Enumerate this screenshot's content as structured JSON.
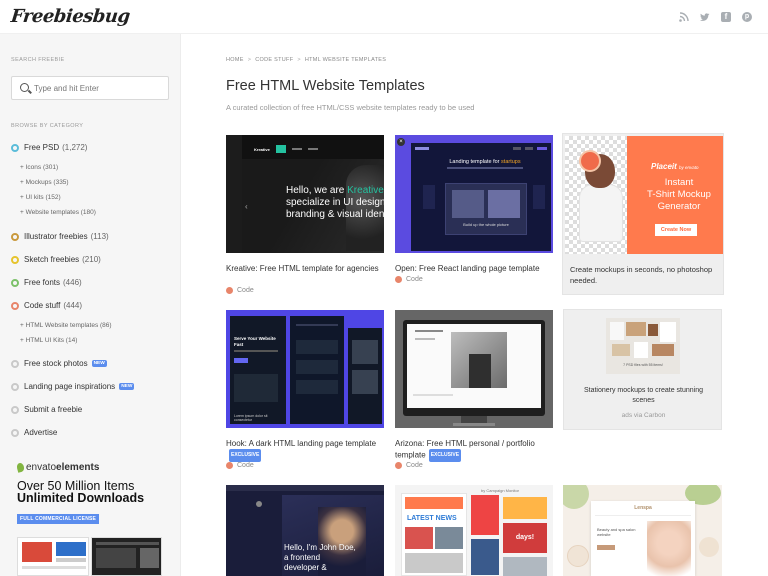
{
  "header": {
    "logo": "Freebiesbug",
    "social": [
      "rss-icon",
      "twitter-icon",
      "facebook-icon",
      "pinterest-icon"
    ]
  },
  "sidebar": {
    "search_heading": "SEARCH FREEBIE",
    "search_placeholder": "Type and hit Enter",
    "browse_heading": "BROWSE BY CATEGORY",
    "categories": [
      {
        "label": "Free PSD",
        "count": "(1,272)",
        "color": "#5bbcd9"
      },
      {
        "label": "Illustrator freebies",
        "count": "(113)",
        "color": "#c9993d"
      },
      {
        "label": "Sketch freebies",
        "count": "(210)",
        "color": "#e6c42d"
      },
      {
        "label": "Free fonts",
        "count": "(446)",
        "color": "#7cc16a"
      },
      {
        "label": "Code stuff",
        "count": "(444)",
        "color": "#e8856a"
      }
    ],
    "psd_subs": [
      "+ Icons (301)",
      "+ Mockups (335)",
      "+ UI kits (152)",
      "+ Website templates (180)"
    ],
    "code_subs": [
      "+ HTML Website templates (86)",
      "+ HTML UI Kits (14)"
    ],
    "links": [
      {
        "label": "Free stock photos",
        "badge": "NEW"
      },
      {
        "label": "Landing page inspirations",
        "badge": "NEW"
      },
      {
        "label": "Submit a freebie",
        "badge": ""
      },
      {
        "label": "Advertise",
        "badge": ""
      }
    ],
    "ad": {
      "brand_a": "envato",
      "brand_b": "elements",
      "line1": "Over 50 Million Items",
      "line2": "Unlimited Downloads",
      "license": "FULL COMMERCIAL LICENSE"
    }
  },
  "main": {
    "breadcrumb": [
      "HOME",
      "CODE STUFF",
      "HTML WEBSITE TEMPLATES"
    ],
    "title": "Free HTML Website Templates",
    "subtitle": "A curated collection of free HTML/CSS website templates ready to be used",
    "cards": [
      {
        "title": "Kreative: Free HTML template for agencies",
        "tag": "Code",
        "exclusive": ""
      },
      {
        "title": "Open: Free React landing page template",
        "tag": "Code",
        "exclusive": ""
      },
      {
        "title": "Hook: A dark HTML landing page template",
        "tag": "Code",
        "exclusive": "EXCLUSIVE"
      },
      {
        "title": "Arizona: Free HTML personal / portfolio template",
        "tag": "Code",
        "exclusive": "EXCLUSIVE"
      }
    ],
    "thumbs": {
      "kreative": {
        "line1": "Hello, we are ",
        "highlight": "Kreative.",
        "line2": "specialize in UI design",
        "line3": "branding & visual identity",
        "nav": "Kreative"
      },
      "open": {
        "headline": "Landing template for ",
        "highlight": "startups",
        "sub": "Build up the whole picture"
      },
      "hook": {
        "headline": "Serve Your Website Fast",
        "caption": "Lorem ipsum dolor sit consectetur"
      },
      "johndoe": {
        "line1": "Hello, I'm John Doe,",
        "line2": "a frontend",
        "line3": "developer &"
      },
      "news": {
        "brand": "by Campaign Monitor",
        "headline": "LATEST NEWS",
        "badge": "days!"
      },
      "lenspa": {
        "brand": "Lenspa",
        "text": "Beauty and spa salon website"
      }
    },
    "ads": {
      "placeit": {
        "brand": "Placeit",
        "by": "by envato",
        "l1": "Instant",
        "l2": "T-Shirt Mockup",
        "l3": "Generator",
        "cta": "Create Now",
        "caption": "Create mockups in seconds, no photoshop needed."
      },
      "carbon": {
        "inner": "7 PSD files with 55 items!",
        "caption": "Stationery mockups to create stunning scenes",
        "via": "ads via Carbon"
      }
    }
  }
}
